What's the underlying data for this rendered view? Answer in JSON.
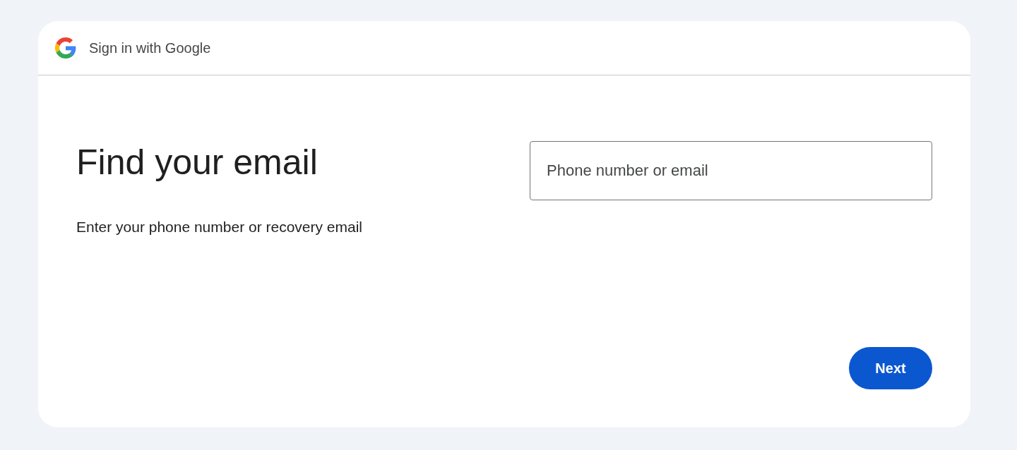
{
  "header": {
    "title": "Sign in with Google"
  },
  "heading": "Find your email",
  "subtitle": "Enter your phone number or recovery email",
  "field": {
    "placeholder": "Phone number or email"
  },
  "buttons": [
    {
      "label": "Next",
      "kind": "primary"
    }
  ]
}
